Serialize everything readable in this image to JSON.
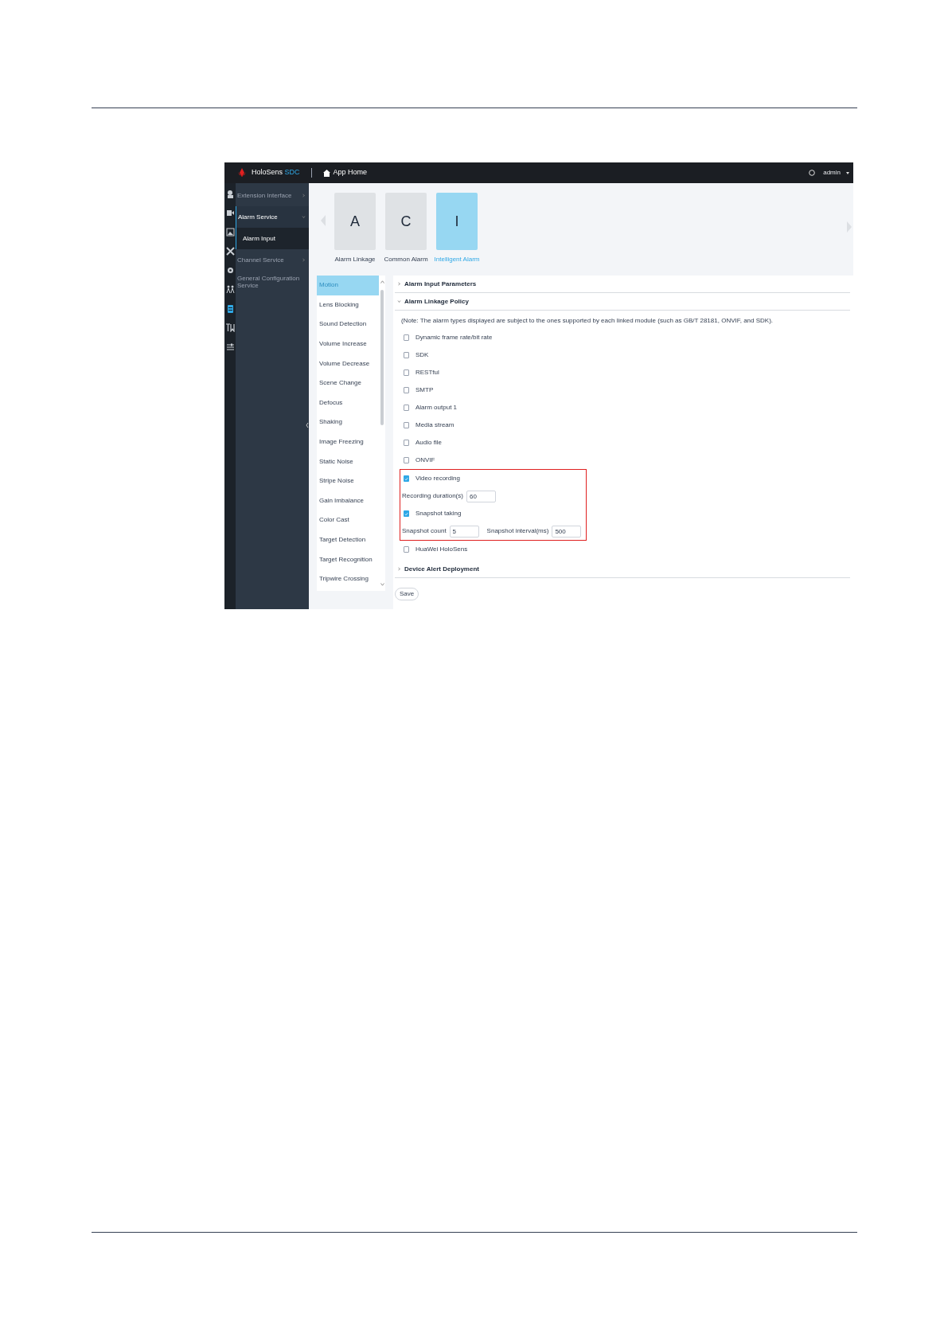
{
  "header": {
    "brand": "HoloSens",
    "brand_accent": "SDC",
    "home_label": "App Home",
    "user": "admin"
  },
  "rail": [
    {
      "selected": false
    },
    {
      "selected": false
    },
    {
      "selected": false
    },
    {
      "selected": false
    },
    {
      "selected": false
    },
    {
      "selected": false
    },
    {
      "selected": true
    },
    {
      "selected": false
    },
    {
      "selected": false
    }
  ],
  "sidebar": {
    "items": [
      {
        "label": "Extension Interface",
        "kind": "group",
        "expanded": false
      },
      {
        "label": "Alarm Service",
        "kind": "group",
        "expanded": true,
        "children": [
          {
            "label": "Alarm Input",
            "selected": true
          }
        ]
      },
      {
        "label": "Channel Service",
        "kind": "group",
        "expanded": false
      },
      {
        "label": "General Configuration Service",
        "kind": "link",
        "expanded": false
      }
    ]
  },
  "apps": [
    {
      "letter": "A",
      "label": "Alarm Linkage",
      "selected": false
    },
    {
      "letter": "C",
      "label": "Common Alarm",
      "selected": false
    },
    {
      "letter": "I",
      "label": "Intelligent Alarm",
      "selected": true
    }
  ],
  "subnav": [
    {
      "label": "Motion",
      "selected": true
    },
    {
      "label": "Lens Blocking",
      "selected": false
    },
    {
      "label": "Sound Detection",
      "selected": false
    },
    {
      "label": "Volume Increase",
      "selected": false
    },
    {
      "label": "Volume Decrease",
      "selected": false
    },
    {
      "label": "Scene Change",
      "selected": false
    },
    {
      "label": "Defocus",
      "selected": false
    },
    {
      "label": "Shaking",
      "selected": false
    },
    {
      "label": "Image Freezing",
      "selected": false
    },
    {
      "label": "Static Noise",
      "selected": false
    },
    {
      "label": "Stripe Noise",
      "selected": false
    },
    {
      "label": "Gain Imbalance",
      "selected": false
    },
    {
      "label": "Color Cast",
      "selected": false
    },
    {
      "label": "Target Detection",
      "selected": false
    },
    {
      "label": "Target Recognition",
      "selected": false
    },
    {
      "label": "Tripwire Crossing",
      "selected": false
    }
  ],
  "sections": [
    {
      "title": "Alarm Input Parameters",
      "expanded": false
    },
    {
      "title": "Alarm Linkage Policy",
      "expanded": true,
      "note": "(Note: The alarm types displayed are subject to the ones supported by each linked module (such as GB/T 28181, ONVIF, and SDK).",
      "options": [
        {
          "label": "Dynamic frame rate/bit rate",
          "checked": false,
          "highlighted": false
        },
        {
          "label": "SDK",
          "checked": false,
          "highlighted": false
        },
        {
          "label": "RESTful",
          "checked": false,
          "highlighted": false
        },
        {
          "label": "SMTP",
          "checked": false,
          "highlighted": false
        },
        {
          "label": "Alarm output 1",
          "checked": false,
          "highlighted": false
        },
        {
          "label": "Media stream",
          "checked": false,
          "highlighted": false
        },
        {
          "label": "Audio file",
          "checked": false,
          "highlighted": false
        },
        {
          "label": "ONVIF",
          "checked": false,
          "highlighted": false
        },
        {
          "label": "Video recording",
          "checked": true,
          "highlighted": true,
          "fields": [
            {
              "label": "Recording duration(s)",
              "value": "60"
            }
          ]
        },
        {
          "label": "Snapshot taking",
          "checked": true,
          "highlighted": true,
          "fields": [
            {
              "label": "Snapshot count",
              "value": "5"
            },
            {
              "label": "Snapshot interval(ms)",
              "value": "500"
            }
          ]
        },
        {
          "label": "HuaWei HoloSens",
          "checked": false,
          "highlighted": false
        }
      ]
    },
    {
      "title": "Device Alert Deployment",
      "expanded": false
    }
  ],
  "save_label": "Save"
}
